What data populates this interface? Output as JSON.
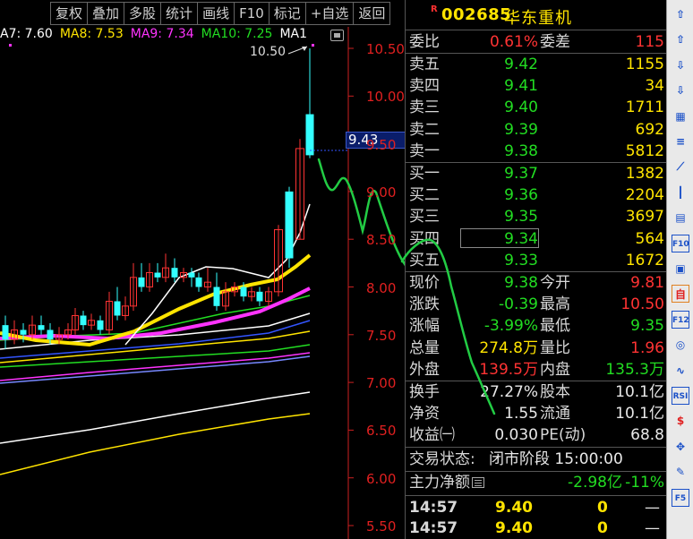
{
  "toolbar": {
    "buttons": [
      "复权",
      "叠加",
      "多股",
      "统计",
      "画线",
      "F10",
      "标记",
      "+自选",
      "返回"
    ]
  },
  "ma_legend": [
    {
      "text": "A7: 7.60",
      "color": "#ffffff"
    },
    {
      "text": "MA8: 7.53",
      "color": "#ffe400"
    },
    {
      "text": "MA9: 7.34",
      "color": "#ff33ff"
    },
    {
      "text": "MA10: 7.25",
      "color": "#22dd22"
    },
    {
      "text": "MA1",
      "color": "#ffffff"
    }
  ],
  "chart": {
    "y_ticks": [
      "10.50",
      "10.00",
      "9.50",
      "9.00",
      "8.50",
      "8.00",
      "7.50",
      "7.00",
      "6.50",
      "6.00",
      "5.50"
    ],
    "current_price_label": "9.43",
    "high_label": "10.50",
    "colors": {
      "up": "#ff3333",
      "down": "#33ffff",
      "axis": "#cc2020"
    }
  },
  "quote": {
    "badge": "R",
    "code": "002685",
    "name": "华东重机",
    "weibi": {
      "label": "委比",
      "value": "0.61%",
      "label2": "委差",
      "value2": "115"
    },
    "sell": [
      {
        "label": "卖五",
        "price": "9.42",
        "vol": "1155"
      },
      {
        "label": "卖四",
        "price": "9.41",
        "vol": "34"
      },
      {
        "label": "卖三",
        "price": "9.40",
        "vol": "1711"
      },
      {
        "label": "卖二",
        "price": "9.39",
        "vol": "692"
      },
      {
        "label": "卖一",
        "price": "9.38",
        "vol": "5812"
      }
    ],
    "buy": [
      {
        "label": "买一",
        "price": "9.37",
        "vol": "1382"
      },
      {
        "label": "买二",
        "price": "9.36",
        "vol": "2204"
      },
      {
        "label": "买三",
        "price": "9.35",
        "vol": "3697"
      },
      {
        "label": "买四",
        "price": "9.34",
        "vol": "564"
      },
      {
        "label": "买五",
        "price": "9.33",
        "vol": "1672"
      }
    ],
    "stats1": [
      {
        "l1": "现价",
        "v1": "9.38",
        "c1": "green",
        "l2": "今开",
        "v2": "9.81",
        "c2": "red"
      },
      {
        "l1": "涨跌",
        "v1": "-0.39",
        "c1": "green",
        "l2": "最高",
        "v2": "10.50",
        "c2": "red"
      },
      {
        "l1": "涨幅",
        "v1": "-3.99%",
        "c1": "green",
        "l2": "最低",
        "v2": "9.35",
        "c2": "green"
      },
      {
        "l1": "总量",
        "v1": "274.8万",
        "c1": "yellow",
        "l2": "量比",
        "v2": "1.96",
        "c2": "red"
      },
      {
        "l1": "外盘",
        "v1": "139.5万",
        "c1": "red",
        "l2": "内盘",
        "v2": "135.3万",
        "c2": "green"
      }
    ],
    "stats2": [
      {
        "l1": "换手",
        "v1": "27.27%",
        "c1": "white",
        "l2": "股本",
        "v2": "10.1亿",
        "c2": "white"
      },
      {
        "l1": "净资",
        "v1": "1.55",
        "c1": "white",
        "l2": "流通",
        "v2": "10.1亿",
        "c2": "white"
      },
      {
        "l1": "收益㈠",
        "v1": "0.030",
        "c1": "white",
        "l2": "PE(动)",
        "v2": "68.8",
        "c2": "white"
      }
    ],
    "trade_status": {
      "label": "交易状态:",
      "value": "闭市阶段 15:00:00"
    },
    "main_flow": {
      "label": "主力净额",
      "value": "-2.98亿",
      "pct": "-11%"
    },
    "ticks": [
      {
        "time": "14:57",
        "price": "9.40",
        "vol": "0",
        "flag": "—"
      },
      {
        "time": "14:57",
        "price": "9.40",
        "vol": "0",
        "flag": "—"
      }
    ]
  },
  "side_icons": [
    "arrow-up-icon",
    "arrow-up-icon",
    "arrow-down-icon",
    "arrow-down-icon",
    "grid-icon",
    "list-icon",
    "line-chart-icon",
    "candle-icon",
    "doc-icon",
    "f10-icon",
    "favorite-icon",
    "self-select-icon",
    "f12-icon",
    "refresh-icon",
    "wave-icon",
    "rsi-icon",
    "dollar-icon",
    "move-icon",
    "pen-icon",
    "f5-icon"
  ],
  "side_labels": {
    "f10": "F10",
    "f12": "F12",
    "rsi": "RSI",
    "f5": "F5",
    "zi": "自",
    "dollar": "$"
  }
}
